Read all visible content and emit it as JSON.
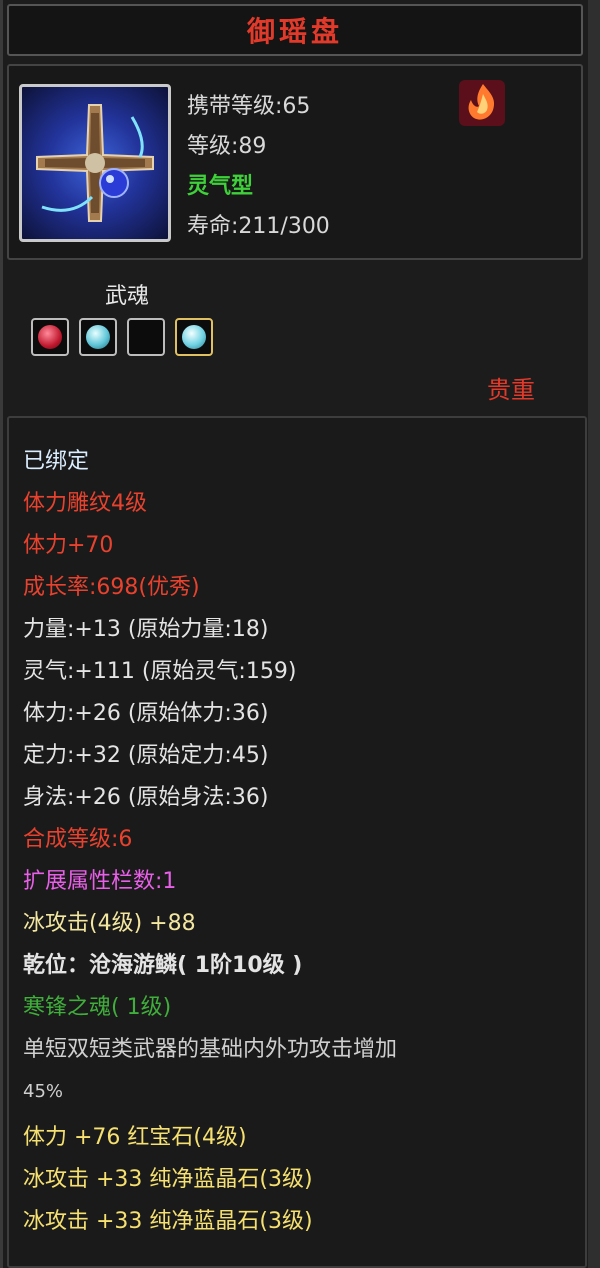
{
  "item": {
    "name": "御瑶盘",
    "carry_level": "携带等级:65",
    "level": "等级:89",
    "type": "灵气型",
    "lifespan": "寿命:211/300"
  },
  "soul": {
    "label": "武魂",
    "slots": [
      "red-gem",
      "blue-gem",
      "empty",
      "blue-gem"
    ]
  },
  "rarity": "贵重",
  "details": {
    "bound": "已绑定",
    "engrave": "体力雕纹4级",
    "engrave_bonus": "体力+70",
    "growth": "成长率:698(优秀)",
    "strength": "力量:+13 (原始力量:18)",
    "spirit": "灵气:+111 (原始灵气:159)",
    "stamina": "体力:+26 (原始体力:36)",
    "focus": "定力:+32 (原始定力:45)",
    "agility": "身法:+26 (原始身法:36)",
    "synth_level": "合成等级:6",
    "ext_slots": "扩展属性栏数:1",
    "ice_attack": "冰攻击(4级) +88",
    "qian": "乾位：沧海游鳞( 1阶10级 )",
    "soul_name": "寒锋之魂( 1级)",
    "soul_effect_1": "单短双短类武器的基础内外功攻击增加",
    "soul_effect_2": "45%",
    "gem_1": "体力 +76 红宝石(4级)",
    "gem_2": "冰攻击 +33 纯净蓝晶石(3级)",
    "gem_3": "冰攻击 +33 纯净蓝晶石(3级)"
  }
}
